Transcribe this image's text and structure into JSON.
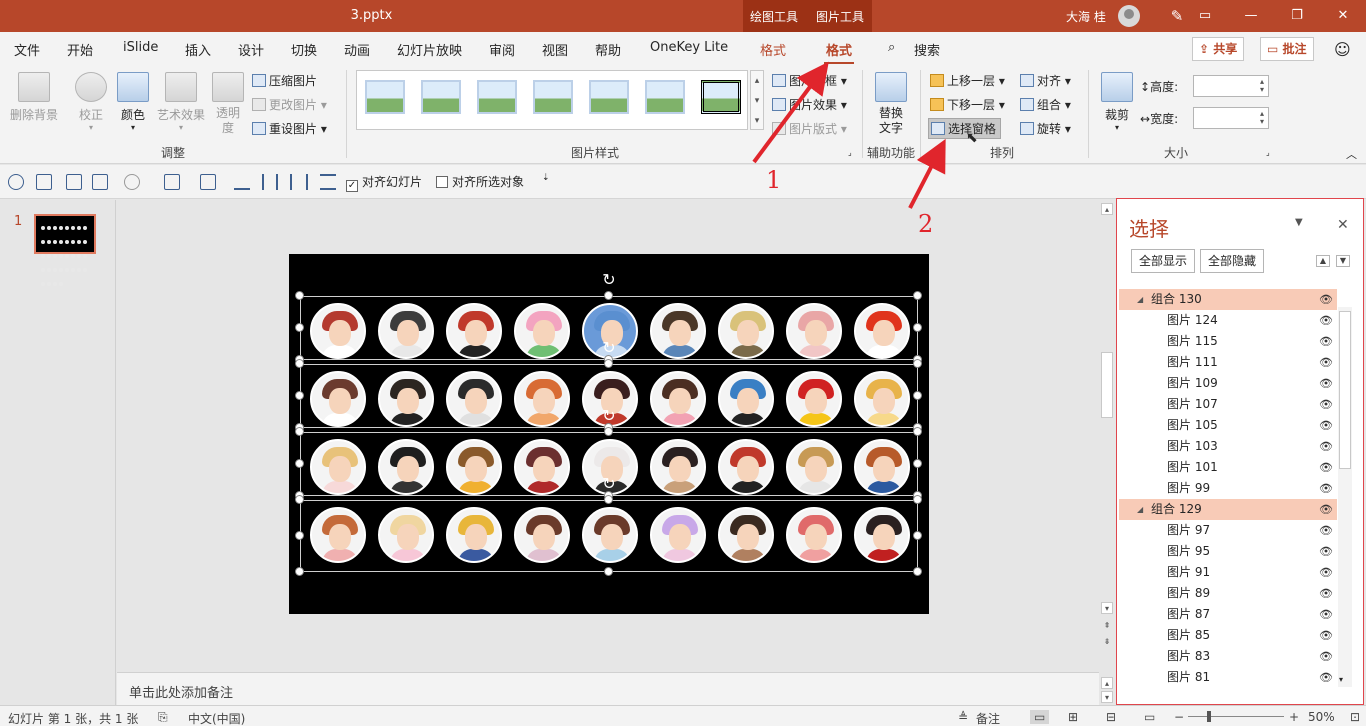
{
  "window": {
    "title": "3.pptx",
    "context_tools": [
      "绘图工具",
      "图片工具"
    ],
    "user": "大海 桂",
    "controls": [
      "—",
      "❐",
      "✕"
    ]
  },
  "tabs": [
    "文件",
    "开始",
    "iSlide",
    "插入",
    "设计",
    "切换",
    "动画",
    "幻灯片放映",
    "审阅",
    "视图",
    "帮助",
    "OneKey Lite",
    "格式",
    "格式"
  ],
  "search_label": "搜索",
  "share_label": "共享",
  "comment_label": "批注",
  "ribbon": {
    "adjust": {
      "remove_bg": "删除背景",
      "correct": "校正",
      "color": "颜色",
      "art_effect": "艺术效果",
      "transparency": "透明度",
      "compress": "压缩图片",
      "change": "更改图片",
      "reset": "重设图片",
      "label": "调整"
    },
    "styles": {
      "border": "图片边框",
      "effect": "图片效果",
      "layout": "图片版式",
      "label": "图片样式"
    },
    "accessibility": {
      "alt_text": "替换文字",
      "label": "辅助功能"
    },
    "arrange": {
      "bring_forward": "上移一层",
      "send_backward": "下移一层",
      "selection_pane": "选择窗格",
      "align": "对齐",
      "group": "组合",
      "rotate": "旋转",
      "label": "排列"
    },
    "size": {
      "crop": "裁剪",
      "height": "高度:",
      "width": "宽度:",
      "label": "大小"
    }
  },
  "quick_toolbar": {
    "align_slide": "对齐幻灯片",
    "align_selected": "对齐所选对象",
    "align_slide_checked": true,
    "align_selected_checked": false
  },
  "slide_number": "1",
  "notes_placeholder": "单击此处添加备注",
  "selection_pane": {
    "title": "选择",
    "show_all": "全部显示",
    "hide_all": "全部隐藏",
    "items": [
      {
        "name": "组合 130",
        "group": true
      },
      {
        "name": "图片 124",
        "group": false
      },
      {
        "name": "图片 115",
        "group": false
      },
      {
        "name": "图片 111",
        "group": false
      },
      {
        "name": "图片 109",
        "group": false
      },
      {
        "name": "图片 107",
        "group": false
      },
      {
        "name": "图片 105",
        "group": false
      },
      {
        "name": "图片 103",
        "group": false
      },
      {
        "name": "图片 101",
        "group": false
      },
      {
        "name": "图片 99",
        "group": false
      },
      {
        "name": "组合 129",
        "group": true
      },
      {
        "name": "图片 97",
        "group": false
      },
      {
        "name": "图片 95",
        "group": false
      },
      {
        "name": "图片 91",
        "group": false
      },
      {
        "name": "图片 89",
        "group": false
      },
      {
        "name": "图片 87",
        "group": false
      },
      {
        "name": "图片 85",
        "group": false
      },
      {
        "name": "图片 83",
        "group": false
      },
      {
        "name": "图片 81",
        "group": false
      }
    ]
  },
  "annotations": [
    "1",
    "2"
  ],
  "status": {
    "slide_info": "幻灯片 第 1 张，共 1 张",
    "language": "中文(中国)",
    "notes": "备注",
    "zoom": "50%"
  },
  "colors": {
    "accent": "#b7472a",
    "annotation": "#e0252c",
    "group_highlight": "#f8cbb7"
  }
}
